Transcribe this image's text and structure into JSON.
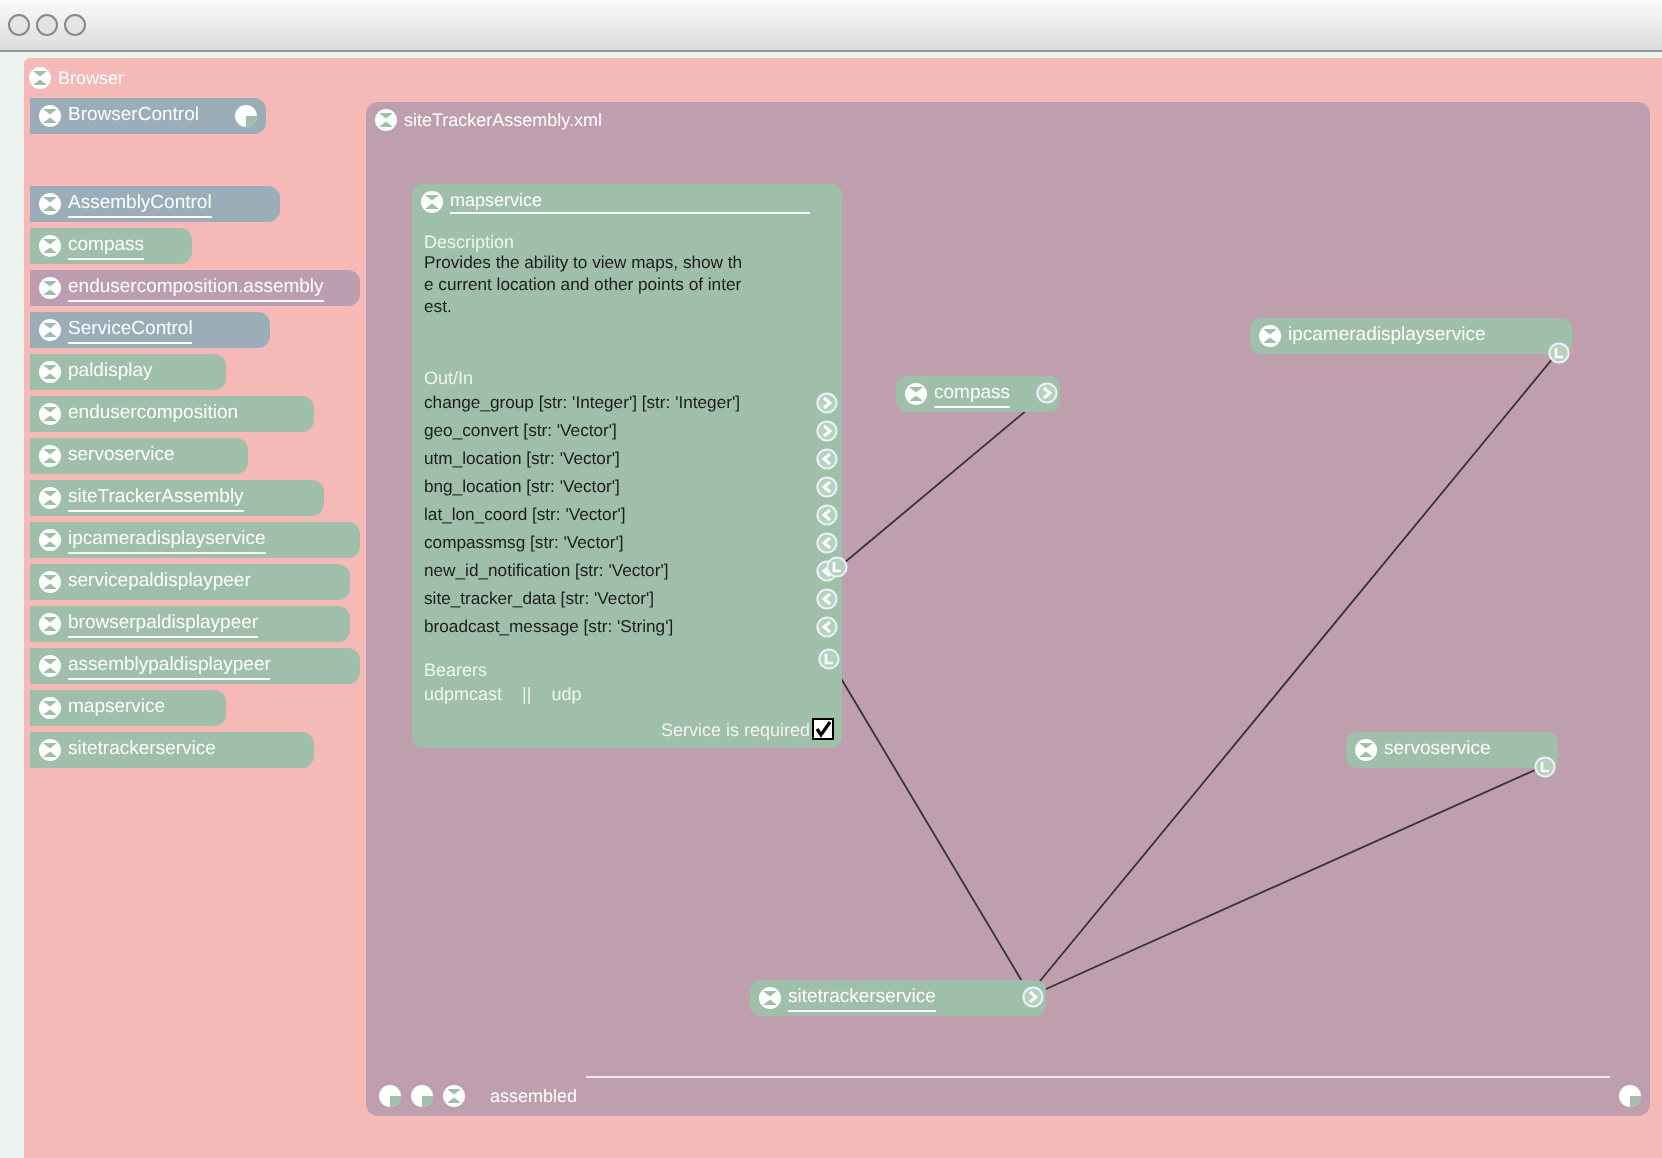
{
  "browser": {
    "title": "Browser",
    "control": {
      "name": "BrowserControl",
      "kind": "control",
      "underlined": false
    },
    "items": [
      {
        "name": "AssemblyControl",
        "kind": "control",
        "underlined": true
      },
      {
        "name": "compass",
        "kind": "service",
        "underlined": true
      },
      {
        "name": "endusercomposition.assembly",
        "kind": "assembly",
        "underlined": true
      },
      {
        "name": "ServiceControl",
        "kind": "control",
        "underlined": true
      },
      {
        "name": "paldisplay",
        "kind": "service",
        "underlined": false
      },
      {
        "name": "endusercomposition",
        "kind": "service",
        "underlined": false
      },
      {
        "name": "servoservice",
        "kind": "service",
        "underlined": false
      },
      {
        "name": "siteTrackerAssembly",
        "kind": "service",
        "underlined": true
      },
      {
        "name": "ipcameradisplayservice",
        "kind": "service",
        "underlined": true
      },
      {
        "name": "servicepaldisplaypeer",
        "kind": "service",
        "underlined": false
      },
      {
        "name": "browserpaldisplaypeer",
        "kind": "service",
        "underlined": true
      },
      {
        "name": "assemblypaldisplaypeer",
        "kind": "service",
        "underlined": true
      },
      {
        "name": "mapservice",
        "kind": "service",
        "underlined": false
      },
      {
        "name": "sitetrackerservice",
        "kind": "service",
        "underlined": false
      }
    ]
  },
  "canvas": {
    "title": "siteTrackerAssembly.xml",
    "detail": {
      "name": "mapservice",
      "underlined": true,
      "description_label": "Description",
      "description": "Provides the ability to view maps, show th\ne current location and other points of inter\nest.",
      "ports_label": "Out/In",
      "ports": [
        {
          "label": "change_group [str: 'Integer'] [str: 'Integer']",
          "kind": "out"
        },
        {
          "label": "geo_convert [str: 'Vector']",
          "kind": "out"
        },
        {
          "label": "utm_location [str: 'Vector']",
          "kind": "in"
        },
        {
          "label": "bng_location [str: 'Vector']",
          "kind": "in"
        },
        {
          "label": "lat_lon_coord [str: 'Vector']",
          "kind": "in"
        },
        {
          "label": "compassmsg [str: 'Vector']",
          "kind": "in"
        },
        {
          "label": "new_id_notification [str: 'Vector']",
          "kind": "in"
        },
        {
          "label": "site_tracker_data [str: 'Vector']",
          "kind": "in"
        },
        {
          "label": "broadcast_message [str: 'String']",
          "kind": "in"
        }
      ],
      "bearers_label": "Bearers",
      "bearers": [
        "udpmcast",
        "||",
        "udp"
      ],
      "required_label": "Service is required",
      "required": true
    },
    "nodes": [
      {
        "name": "compass",
        "underlined": true
      },
      {
        "name": "ipcameradisplayservice",
        "underlined": false
      },
      {
        "name": "servoservice",
        "underlined": false
      },
      {
        "name": "sitetrackerservice",
        "underlined": true
      }
    ],
    "status": "assembled"
  }
}
